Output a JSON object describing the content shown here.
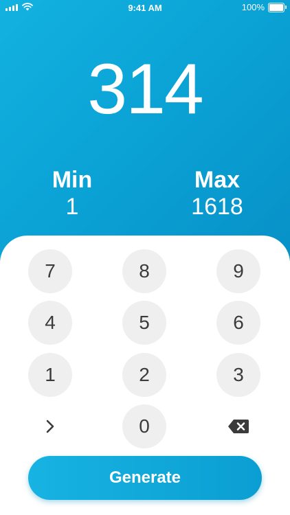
{
  "status_bar": {
    "time": "9:41 AM",
    "battery": "100%",
    "icons": [
      "signal-icon",
      "wifi-icon",
      "battery-icon"
    ]
  },
  "display": {
    "result": "314",
    "min_label": "Min",
    "min_value": "1",
    "max_label": "Max",
    "max_value": "1618"
  },
  "keypad": {
    "keys": [
      "7",
      "8",
      "9",
      "4",
      "5",
      "6",
      "1",
      "2",
      "3"
    ],
    "zero": "0",
    "next_icon": "chevron-right-icon",
    "delete_icon": "backspace-icon"
  },
  "generate_label": "Generate",
  "colors": {
    "accent": "#0aa0d4",
    "key_bg": "#efefef",
    "key_text": "#3b3b3b"
  }
}
